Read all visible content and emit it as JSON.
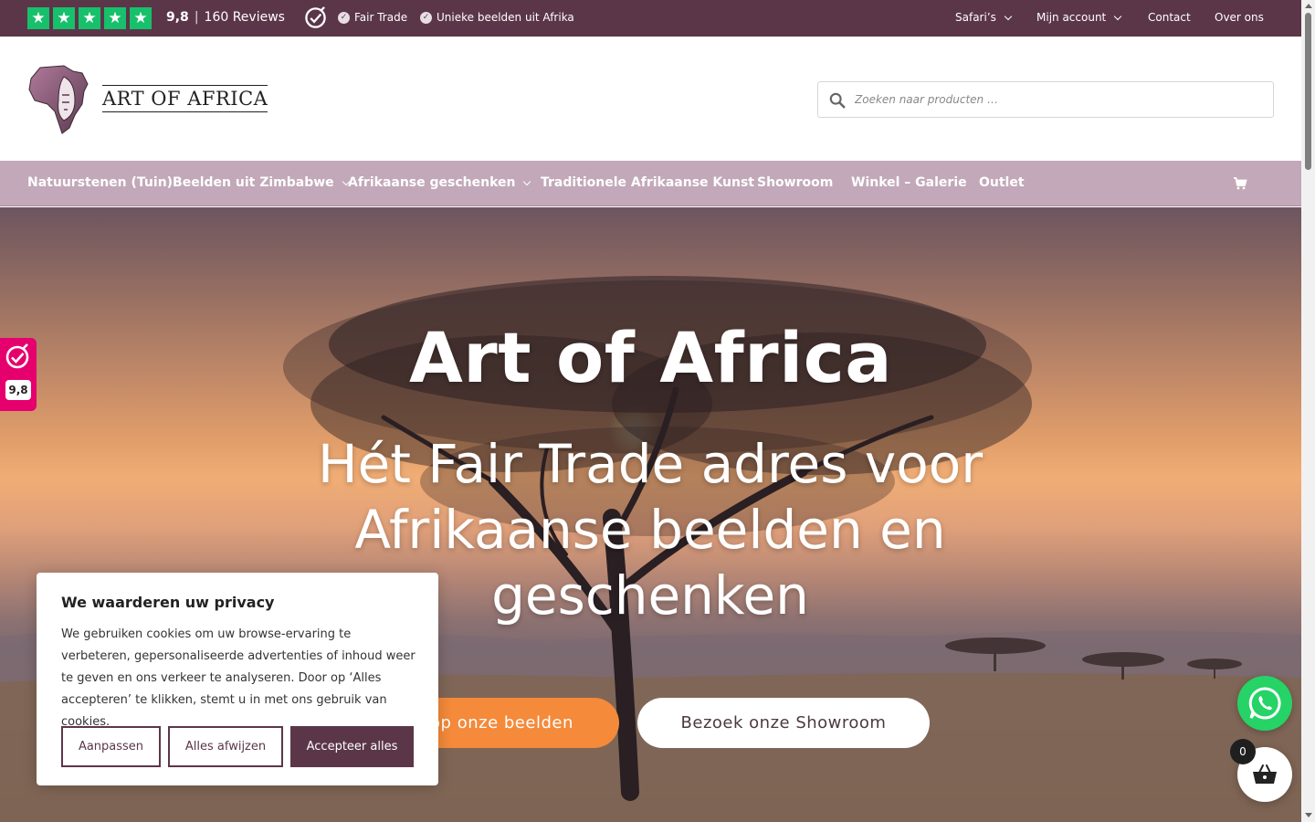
{
  "topbar": {
    "rating_score": "9,8",
    "rating_separator": "|",
    "reviews": "160 Reviews",
    "usp": [
      "Fair Trade",
      "Unieke beelden uit Afrika"
    ],
    "nav": [
      "Safari’s",
      "Mijn account",
      "Contact",
      "Over ons"
    ],
    "bg_color": "#5b3649",
    "star_color": "#17c06a"
  },
  "header": {
    "logo_text": "ART OF AFRICA",
    "search_placeholder": "Zoeken naar producten …"
  },
  "mainnav": {
    "items": [
      "Natuurstenen (Tuin)Beelden uit Zimbabwe",
      "Afrikaanse geschenken",
      "Traditionele Afrikaanse Kunst",
      "Showroom",
      "Winkel – Galerie",
      "Outlet"
    ],
    "bg_color": "#c2a8b8"
  },
  "hero": {
    "title": "Art of Africa",
    "subtitle": "Hét Fair Trade adres voor Afrikaanse beelden en geschenken",
    "button_primary": "Koop onze beelden",
    "button_secondary": "Bezoek onze Showroom",
    "primary_color": "#f48a3a"
  },
  "kiyoh": {
    "score": "9,8",
    "color": "#e5006e"
  },
  "cookie": {
    "title": "We waarderen uw privacy",
    "text": "We gebruiken cookies om uw browse-ervaring te verbeteren, gepersonaliseerde advertenties of inhoud weer te geven en ons verkeer te analyseren. Door op ‘Alles accepteren’ te klikken, stemt u in met ons gebruik van cookies.",
    "btn_customize": "Aanpassen",
    "btn_reject": "Alles afwijzen",
    "btn_accept": "Accepteer alles"
  },
  "cart": {
    "count": "0"
  }
}
